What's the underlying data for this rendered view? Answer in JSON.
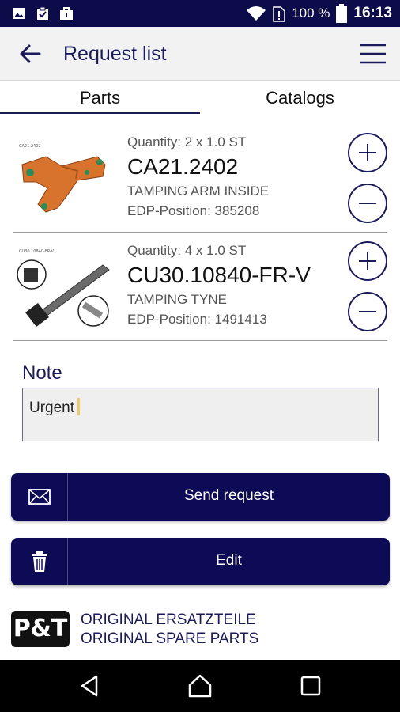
{
  "status_bar": {
    "battery": "100 %",
    "time": "16:13",
    "icons": [
      "image-icon",
      "clipboard-icon",
      "briefcase-icon",
      "wifi-icon",
      "sim-icon",
      "battery-icon"
    ]
  },
  "app_bar": {
    "title": "Request list",
    "back_icon": "arrow-left-icon",
    "menu_icon": "hamburger-menu-icon"
  },
  "tabs": [
    {
      "label": "Parts",
      "selected": true
    },
    {
      "label": "Catalogs",
      "selected": false
    }
  ],
  "items": [
    {
      "quantity": "Quantity: 2 x 1.0 ST",
      "part_number": "CA21.2402",
      "description": "TAMPING ARM INSIDE",
      "edp": "EDP-Position: 385208",
      "thumb_caption": "CA21.2402"
    },
    {
      "quantity": "Quantity: 4 x 1.0 ST",
      "part_number": "CU30.10840-FR-V",
      "description": "TAMPING TYNE",
      "edp": "EDP-Position: 1491413",
      "thumb_caption": "CU30.10840-FR-V"
    }
  ],
  "note": {
    "label": "Note",
    "value": "Urgent"
  },
  "buttons": {
    "send": "Send request",
    "edit": "Edit"
  },
  "footer": {
    "logo": "P&T",
    "line1": "ORIGINAL ERSATZTEILE",
    "line2": "ORIGINAL SPARE PARTS"
  },
  "colors": {
    "primary": "#0d0b56",
    "accent_text": "#1b1b5a",
    "status_bar": "#0c0c4a",
    "thumb_orange": "#d8732e"
  }
}
